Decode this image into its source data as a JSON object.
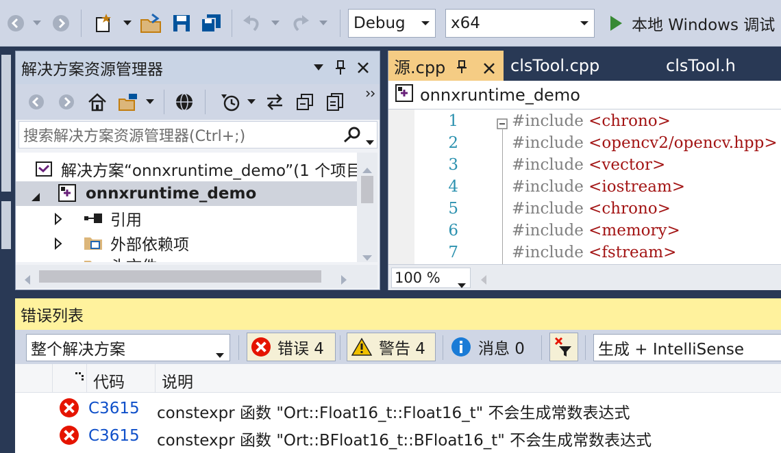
{
  "toolbar": {
    "config_value": "Debug",
    "platform_value": "x64",
    "run_label": "本地 Windows 调试",
    "colors": {
      "background": "#cfd6e5",
      "run_icon": "#388a34"
    },
    "icons": [
      "back-icon",
      "forward-icon",
      "new-project-icon",
      "open-file-icon",
      "save-icon",
      "save-all-icon",
      "undo-icon",
      "redo-icon",
      "play-icon"
    ]
  },
  "solution_explorer": {
    "title": "解决方案资源管理器",
    "search_placeholder": "搜索解决方案资源管理器(Ctrl+;)",
    "tree": {
      "solution_label": "解决方案“onnxruntime_demo”(1 个项目",
      "project_label": "onnxruntime_demo",
      "references_label": "引用",
      "external_deps_label": "外部依赖项",
      "headers_label": "头文件"
    }
  },
  "editor": {
    "tabs": [
      {
        "label": "源.cpp",
        "active": true
      },
      {
        "label": "clsTool.cpp",
        "active": false
      },
      {
        "label": "clsTool.h",
        "active": false
      }
    ],
    "nav_project": "onnxruntime_demo",
    "zoom": "100 %",
    "lines": [
      {
        "num": "1",
        "directive": "#include",
        "target": "<chrono>"
      },
      {
        "num": "2",
        "directive": "#include",
        "target": "<opencv2/opencv.hpp>"
      },
      {
        "num": "3",
        "directive": "#include",
        "target": "<vector>"
      },
      {
        "num": "4",
        "directive": "#include",
        "target": "<iostream>"
      },
      {
        "num": "5",
        "directive": "#include",
        "target": "<chrono>"
      },
      {
        "num": "6",
        "directive": "#include",
        "target": "<memory>"
      },
      {
        "num": "7",
        "directive": "#include",
        "target": "<fstream>"
      }
    ],
    "colors": {
      "tab_active": "#f5cc84",
      "line_number": "#2b91af",
      "keyword": "#808080",
      "string": "#a31515"
    }
  },
  "error_list": {
    "title": "错误列表",
    "scope_value": "整个解决方案",
    "errors_label": "错误 4",
    "warnings_label": "警告 4",
    "messages_label": "消息 0",
    "source_filter": "生成 + IntelliSense",
    "headers": {
      "code": "代码",
      "description": "说明"
    },
    "rows": [
      {
        "code": "C3615",
        "description": "constexpr 函数 \"Ort::Float16_t::Float16_t\" 不会生成常数表达式"
      },
      {
        "code": "C3615",
        "description": "constexpr 函数 \"Ort::BFloat16_t::BFloat16_t\" 不会生成常数表达式"
      }
    ],
    "colors": {
      "title_bar": "#fff29d",
      "error": "#e51400",
      "warning": "#f0c000",
      "info": "#1a7bd6",
      "code_link": "#0e4fc9"
    }
  }
}
